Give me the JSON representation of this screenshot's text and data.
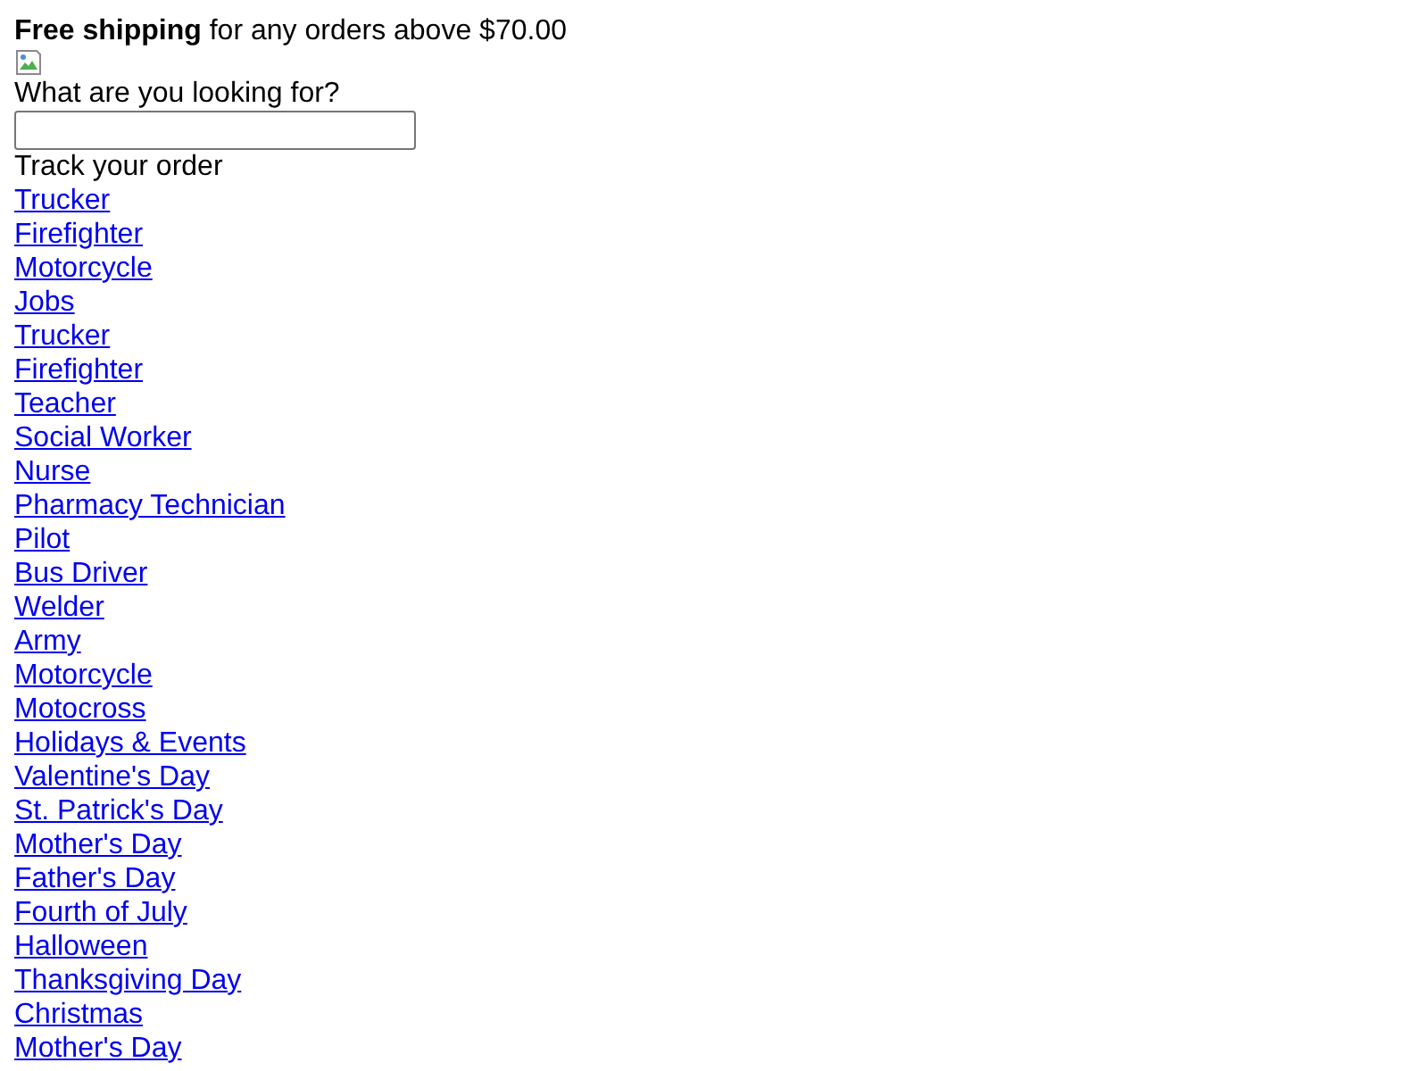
{
  "banner": {
    "text": "**Free shipping** for any orders above $70.00"
  },
  "search": {
    "label": "What are you looking for?"
  },
  "track": {
    "label": "Track your order"
  },
  "links": [
    {
      "label": "Trucker"
    },
    {
      "label": "Firefighter"
    },
    {
      "label": "Motorcycle"
    },
    {
      "label": "Jobs"
    },
    {
      "label": "Trucker"
    },
    {
      "label": "Firefighter"
    },
    {
      "label": "Teacher"
    },
    {
      "label": "Social Worker"
    },
    {
      "label": "Nurse"
    },
    {
      "label": "Pharmacy Technician"
    },
    {
      "label": "Pilot"
    },
    {
      "label": "Bus Driver"
    },
    {
      "label": "Welder"
    },
    {
      "label": "Army"
    },
    {
      "label": "Motorcycle"
    },
    {
      "label": "Motocross"
    },
    {
      "label": "Holidays & Events"
    },
    {
      "label": "Valentine's Day"
    },
    {
      "label": "St. Patrick's Day"
    },
    {
      "label": "Mother's Day"
    },
    {
      "label": "Father's Day"
    },
    {
      "label": "Fourth of July"
    },
    {
      "label": "Halloween"
    },
    {
      "label": "Thanksgiving Day"
    },
    {
      "label": "Christmas"
    },
    {
      "label": "Mother's Day"
    }
  ]
}
